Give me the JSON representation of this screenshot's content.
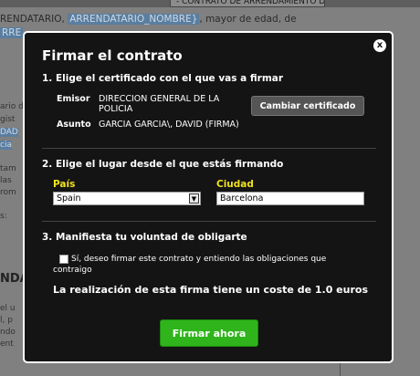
{
  "background": {
    "select_value": "- CONTRATO DE ARRENDAMIENTO DE",
    "line1_prefix": "RENDATARIO,",
    "line1_highlight": "ARRENDATARIO_NOMBRE}",
    "line1_suffix": ", mayor de edad, de",
    "line2": "RRE",
    "left_fragments": [
      "ario d",
      "gist",
      "DAD",
      "cia",
      "tam",
      "las",
      "rom",
      "s:",
      "NDA",
      "el u",
      "l, p",
      "ndo",
      "ent"
    ],
    "bold_fragment": "NDA"
  },
  "modal": {
    "title": "Firmar el contrato",
    "close_label": "x",
    "step1": {
      "heading": "1. Elige el certificado con el que vas a firmar",
      "emisor_label": "Emisor",
      "emisor_value": "DIRECCION GENERAL DE LA POLICIA",
      "asunto_label": "Asunto",
      "asunto_value": "GARCIA GARCIA\\, DAVID (FIRMA)",
      "change_button": "Cambiar certificado"
    },
    "step2": {
      "heading": "2. Elige el lugar desde el que estás firmando",
      "country_label": "País",
      "country_value": "Spain",
      "city_label": "Ciudad",
      "city_value": "Barcelona"
    },
    "step3": {
      "heading": "3. Manifiesta tu voluntad de obligarte",
      "checkbox_text": "Sí, deseo firmar este contrato y entiendo las obligaciones que contraigo",
      "cost_text": "La realización de esta firma tiene un coste de 1.0 euros"
    },
    "sign_button": "Firmar ahora"
  }
}
